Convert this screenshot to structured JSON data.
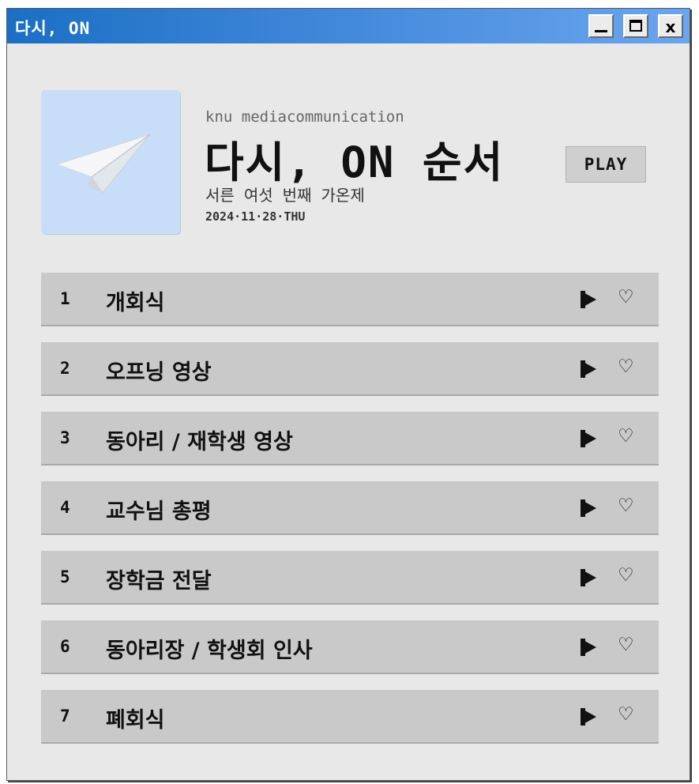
{
  "window": {
    "title": "다시, ON",
    "minimize_icon": "minimize-icon",
    "maximize_icon": "maximize-icon",
    "close_label": "x"
  },
  "album": {
    "cover_icon": "paper-plane-icon",
    "subtitle": "knu mediacommunication",
    "title": "다시, ON 순서",
    "description": "서른 여섯 번째 가온제",
    "date": "2024·11·28·THU",
    "play_label": "PLAY"
  },
  "tracks": [
    {
      "number": "1",
      "name": "개회식"
    },
    {
      "number": "2",
      "name": "오프닝 영상"
    },
    {
      "number": "3",
      "name": "동아리 / 재학생 영상"
    },
    {
      "number": "4",
      "name": "교수님 총평"
    },
    {
      "number": "5",
      "name": "장학금 전달"
    },
    {
      "number": "6",
      "name": "동아리장 / 학생회 인사"
    },
    {
      "number": "7",
      "name": "폐회식"
    }
  ],
  "icons": {
    "play": "play-icon",
    "heart": "heart-icon",
    "heart_glyph": "♡"
  },
  "colors": {
    "titlebar_start": "#1a6fc4",
    "titlebar_end": "#6aa6ee",
    "window_bg": "#e8e8e8",
    "row_bg": "#c9c9c9",
    "cover_bg": "#c8def8"
  }
}
